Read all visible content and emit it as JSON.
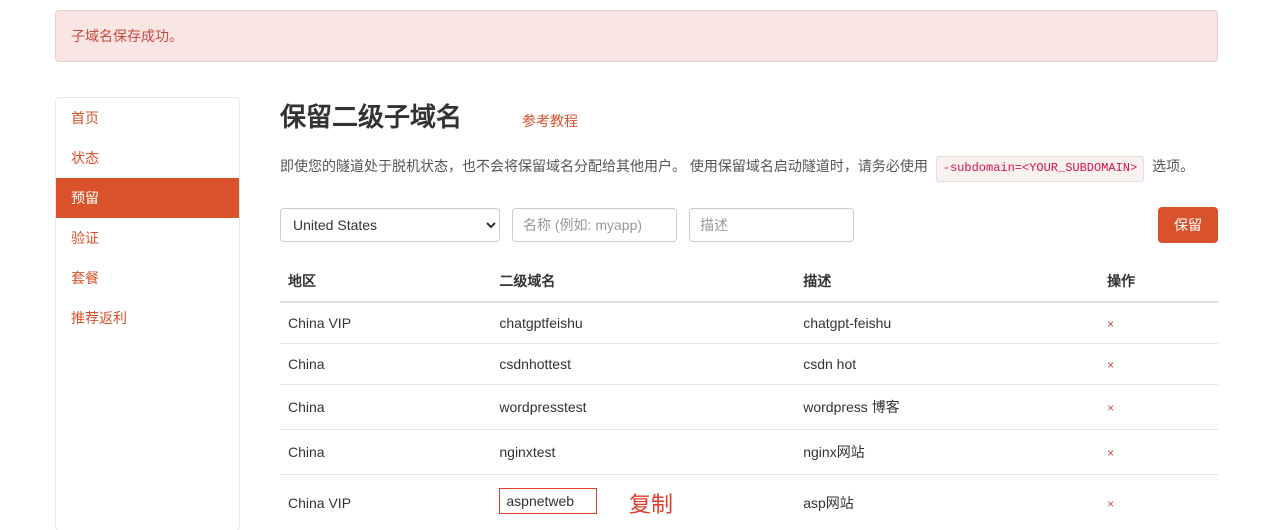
{
  "alert": {
    "text": "子域名保存成功。"
  },
  "sidebar": {
    "items": [
      {
        "label": "首页"
      },
      {
        "label": "状态"
      },
      {
        "label": "预留"
      },
      {
        "label": "验证"
      },
      {
        "label": "套餐"
      },
      {
        "label": "推荐返利"
      }
    ],
    "active_index": 2
  },
  "header": {
    "title": "保留二级子域名",
    "help": "参考教程"
  },
  "description": {
    "pre": "即使您的隧道处于脱机状态，也不会将保留域名分配给其他用户。 使用保留域名启动隧道时，请务必使用",
    "code": "-subdomain=<YOUR_SUBDOMAIN>",
    "post": "选项。"
  },
  "form": {
    "region_selected": "United States",
    "name_placeholder": "名称 (例如: myapp)",
    "desc_placeholder": "描述",
    "reserve_label": "保留"
  },
  "table": {
    "headers": {
      "region": "地区",
      "subdomain": "二级域名",
      "desc": "描述",
      "op": "操作"
    },
    "rows": [
      {
        "region": "China VIP",
        "sub": "chatgptfeishu",
        "desc": "chatgpt-feishu"
      },
      {
        "region": "China",
        "sub": "csdnhottest",
        "desc": "csdn hot"
      },
      {
        "region": "China",
        "sub": "wordpresstest",
        "desc": "wordpress 博客"
      },
      {
        "region": "China",
        "sub": "nginxtest",
        "desc": "nginx网站"
      },
      {
        "region": "China VIP",
        "sub": "aspnetweb",
        "desc": "asp网站"
      }
    ]
  },
  "annotation": {
    "copy_label": "复制"
  },
  "icons": {
    "delete": "×"
  }
}
